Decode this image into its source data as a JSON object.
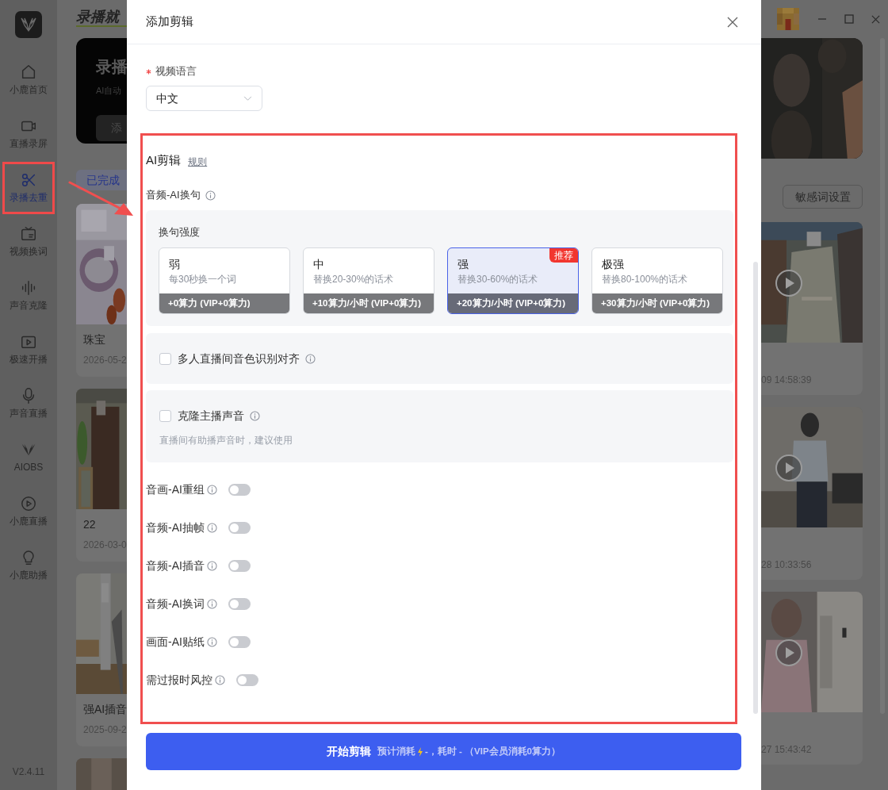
{
  "sidebar": {
    "items": [
      {
        "label": "小鹿首页",
        "selected": false
      },
      {
        "label": "直播录屏",
        "selected": false
      },
      {
        "label": "录播去重",
        "selected": true
      },
      {
        "label": "视频换词",
        "selected": false
      },
      {
        "label": "声音克隆",
        "selected": false
      },
      {
        "label": "极速开播",
        "selected": false
      },
      {
        "label": "声音直播",
        "selected": false
      },
      {
        "label": "AIOBS",
        "selected": false
      },
      {
        "label": "小鹿直播",
        "selected": false
      },
      {
        "label": "小鹿助播",
        "selected": false
      }
    ],
    "version": "V2.4.11"
  },
  "background": {
    "header_title": "录播就",
    "banner": {
      "title": "录播",
      "subtitle": "AI自动",
      "button": "添"
    },
    "tab": "已完成",
    "settings_button": "敏感词设置",
    "left_cards": [
      {
        "title": "珠宝",
        "date": "2026-05-2"
      },
      {
        "title": "22",
        "date": "2026-03-0"
      },
      {
        "title": "强AI插音",
        "date": "2025-09-2"
      }
    ],
    "right_cards": [
      {
        "date": "09 14:58:39"
      },
      {
        "date": "28 10:33:56"
      },
      {
        "date": "27 15:43:42"
      }
    ]
  },
  "dialog": {
    "title": "添加剪辑",
    "language": {
      "label": "视频语言",
      "required": true,
      "value": "中文"
    },
    "ai_edit": {
      "title": "AI剪辑",
      "rules_link": "规则",
      "rewrite": {
        "label": "音频-AI换句",
        "intensity_label": "换句强度",
        "options": [
          {
            "title": "弱",
            "description": "每30秒换一个词",
            "cost": "+0算力 (VIP+0算力)",
            "selected": false
          },
          {
            "title": "中",
            "description": "替换20-30%的话术",
            "cost": "+10算力/小时 (VIP+0算力)",
            "selected": false
          },
          {
            "title": "强",
            "description": "替换30-60%的话术",
            "cost": "+20算力/小时 (VIP+0算力)",
            "selected": true,
            "badge": "推荐"
          },
          {
            "title": "极强",
            "description": "替换80-100%的话术",
            "cost": "+30算力/小时 (VIP+0算力)",
            "selected": false
          }
        ]
      },
      "checkbox_panels": [
        {
          "label": "多人直播间音色识别对齐",
          "checked": false
        },
        {
          "label": "克隆主播声音",
          "checked": false,
          "hint": "直播间有助播声音时，建议使用"
        }
      ],
      "toggles": [
        {
          "label": "音画-AI重组",
          "on": false
        },
        {
          "label": "音频-AI抽帧",
          "on": false
        },
        {
          "label": "音频-AI插音",
          "on": false
        },
        {
          "label": "音频-AI换词",
          "on": false
        },
        {
          "label": "画面-AI贴纸",
          "on": false
        },
        {
          "label": "需过报时风控",
          "on": false
        }
      ]
    },
    "start_button": {
      "label": "开始剪辑",
      "estimate_prefix": "预计消耗",
      "estimate_rest": "-，耗时 - （VIP会员消耗0算力）"
    }
  }
}
